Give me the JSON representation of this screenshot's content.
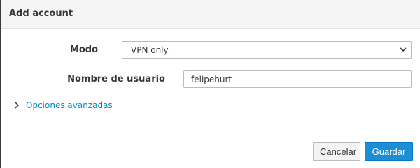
{
  "dialog": {
    "title": "Add account"
  },
  "form": {
    "mode_label": "Modo",
    "mode_value": "VPN only",
    "username_label": "Nombre de usuario",
    "username_value": "felipehurt"
  },
  "advanced": {
    "label": "Opciones avanzadas"
  },
  "buttons": {
    "cancel_label": "Cancelar",
    "save_label": "Guardar"
  },
  "colors": {
    "link": "#0088ce",
    "primary": "#1b8ed6",
    "header_bg": "#f5f5f5"
  },
  "icons": {
    "select_chevron": "chevron-down-icon",
    "advanced_chevron": "chevron-right-icon"
  }
}
